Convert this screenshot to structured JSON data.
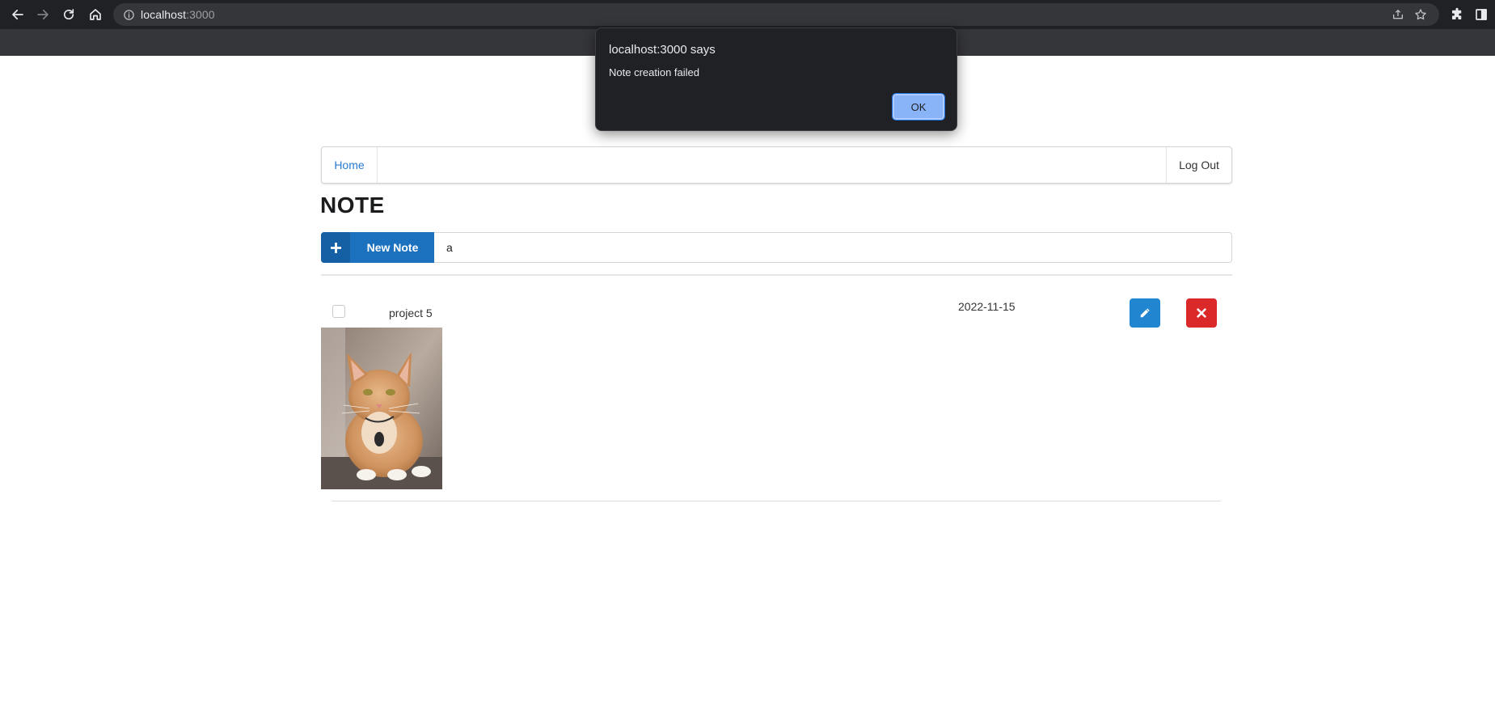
{
  "browser": {
    "url_host": "localhost",
    "url_port": ":3000",
    "icons": [
      "back-arrow-icon",
      "forward-arrow-icon",
      "reload-icon",
      "home-icon",
      "info-icon",
      "share-icon",
      "star-icon",
      "extensions-icon",
      "sidepanel-icon"
    ]
  },
  "navbar": {
    "home_label": "Home",
    "logout_label": "Log Out"
  },
  "page": {
    "title": "NOTE"
  },
  "new_note": {
    "button_label": "New Note",
    "input_value": "a"
  },
  "notes": [
    {
      "title": "project 5",
      "date": "2022-11-15",
      "checked": false
    }
  ],
  "dialog": {
    "title": "localhost:3000 says",
    "message": "Note creation failed",
    "ok_label": "OK"
  },
  "colors": {
    "primary": "#2185d0",
    "new_note": "#1c71bf",
    "danger": "#db2828",
    "link": "#2a7bd1"
  }
}
